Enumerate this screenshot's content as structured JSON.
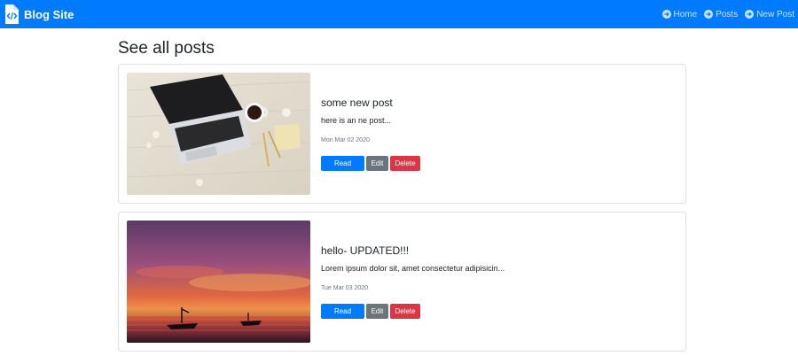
{
  "navbar": {
    "brand": "Blog Site",
    "links": [
      {
        "label": "Home",
        "icon": "arrow-circle-right-icon"
      },
      {
        "label": "Posts",
        "icon": "arrow-circle-right-icon"
      },
      {
        "label": "New Post",
        "icon": "arrow-circle-right-icon"
      }
    ],
    "background": "#007bff"
  },
  "page": {
    "title": "See all posts"
  },
  "posts": [
    {
      "title": "some new post",
      "excerpt": "here is an ne post...",
      "date": "Mon Mar 02 2020",
      "image": "laptop-on-desk-photo",
      "actions": {
        "read_more": "Read More",
        "edit": "Edit",
        "delete": "Delete"
      }
    },
    {
      "title": "hello- UPDATED!!!",
      "excerpt": "Lorem ipsum dolor sit, amet consectetur adipisicin...",
      "date": "Tue Mar 03 2020",
      "image": "sunset-boats-photo",
      "actions": {
        "read_more": "Read More",
        "edit": "Edit",
        "delete": "Delete"
      }
    }
  ],
  "colors": {
    "primary": "#007bff",
    "secondary": "#6c757d",
    "danger": "#dc3545"
  }
}
